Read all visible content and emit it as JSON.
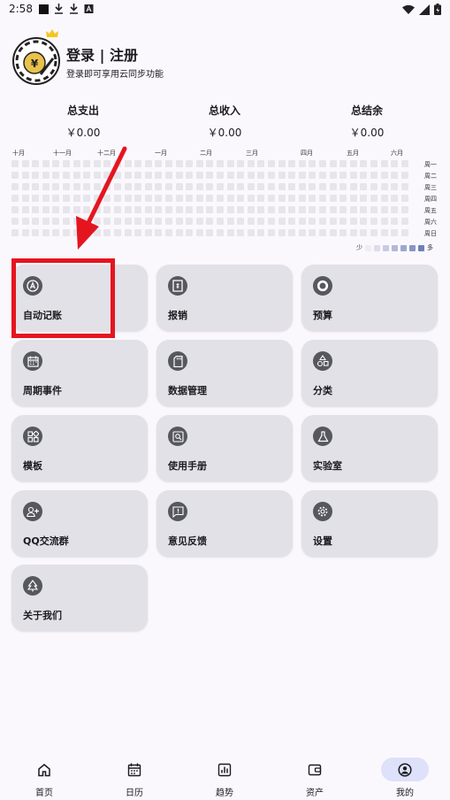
{
  "status_bar": {
    "time": "2:58"
  },
  "profile": {
    "title": "登录 | 注册",
    "subtitle": "登录即可享用云同步功能"
  },
  "totals": [
    {
      "label": "总支出",
      "value": "￥0.00"
    },
    {
      "label": "总收入",
      "value": "￥0.00"
    },
    {
      "label": "总结余",
      "value": "￥0.00"
    }
  ],
  "heatmap": {
    "months": [
      "十月",
      "十一月",
      "十二月",
      "一月",
      "二月",
      "三月",
      "四月",
      "五月",
      "六月"
    ],
    "days": [
      "周一",
      "周二",
      "周三",
      "周四",
      "周五",
      "周六",
      "周日"
    ],
    "legend_less": "少",
    "legend_more": "多",
    "legend_colors": [
      "#eeedf3",
      "#dcdde8",
      "#c8cbe0",
      "#b3b9d6",
      "#9ea7cc",
      "#8995c2",
      "#7080b4"
    ]
  },
  "menu": [
    {
      "label": "自动记账",
      "icon": "auto-a-icon"
    },
    {
      "label": "报销",
      "icon": "reimburse-icon"
    },
    {
      "label": "预算",
      "icon": "budget-ring-icon"
    },
    {
      "label": "周期事件",
      "icon": "calendar-icon"
    },
    {
      "label": "数据管理",
      "icon": "sd-card-icon"
    },
    {
      "label": "分类",
      "icon": "category-shapes-icon"
    },
    {
      "label": "模板",
      "icon": "template-icon"
    },
    {
      "label": "使用手册",
      "icon": "manual-icon"
    },
    {
      "label": "实验室",
      "icon": "flask-icon"
    },
    {
      "label": "QQ交流群",
      "icon": "group-add-icon"
    },
    {
      "label": "意见反馈",
      "icon": "feedback-icon"
    },
    {
      "label": "设置",
      "icon": "gear-icon"
    },
    {
      "label": "关于我们",
      "icon": "tree-icon"
    }
  ],
  "bottom_nav": [
    {
      "label": "首页",
      "icon": "home-icon"
    },
    {
      "label": "日历",
      "icon": "calendar-icon"
    },
    {
      "label": "趋势",
      "icon": "bar-chart-icon"
    },
    {
      "label": "资产",
      "icon": "wallet-icon"
    },
    {
      "label": "我的",
      "icon": "person-circle-icon",
      "active": true
    }
  ],
  "colors": {
    "annotation_red": "#e5151f",
    "card_bg": "#e1e1e7",
    "icon_bg": "#56575f",
    "nav_active": "#dde1f9"
  }
}
